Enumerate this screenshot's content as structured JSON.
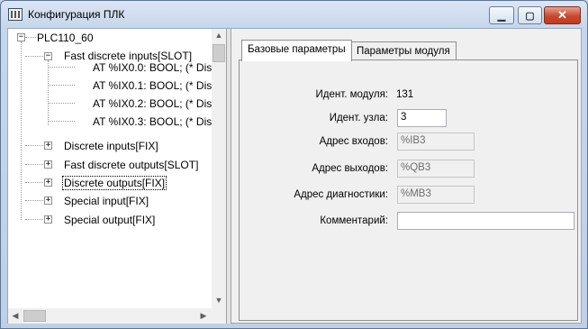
{
  "window": {
    "title": "Конфигурация ПЛК",
    "controls": {
      "minimize": "▁",
      "maximize": "▢",
      "close": "✕"
    }
  },
  "tree": {
    "root": "PLC110_60",
    "nodes": [
      {
        "label": "Fast discrete inputs[SLOT]",
        "expander": "−",
        "children": [
          "AT %IX0.0: BOOL; (* Dis",
          "AT %IX0.1: BOOL; (* Dis",
          "AT %IX0.2: BOOL; (* Dis",
          "AT %IX0.3: BOOL; (* Dis"
        ]
      },
      {
        "label": "Discrete inputs[FIX]",
        "expander": "+"
      },
      {
        "label": "Fast discrete outputs[SLOT]",
        "expander": "+"
      },
      {
        "label": "Discrete outputs[FIX]",
        "expander": "+",
        "selected": true
      },
      {
        "label": "Special input[FIX]",
        "expander": "+"
      },
      {
        "label": "Special output[FIX]",
        "expander": "+"
      }
    ],
    "root_expander": "−",
    "scroll": {
      "up": "▲",
      "down": "▼",
      "left": "◀",
      "right": "▶"
    }
  },
  "tabs": [
    {
      "label": "Базовые параметры",
      "active": true
    },
    {
      "label": "Параметры модуля",
      "active": false
    }
  ],
  "form": {
    "module_id_label": "Идент. модуля:",
    "module_id_value": "131",
    "node_id_label": "Идент. узла:",
    "node_id_value": "3",
    "input_addr_label": "Адрес входов:",
    "input_addr_value": "%IB3",
    "output_addr_label": "Адрес выходов:",
    "output_addr_value": "%QB3",
    "diag_addr_label": "Адрес диагностики:",
    "diag_addr_value": "%MB3",
    "comment_label": "Комментарий:",
    "comment_value": ""
  }
}
